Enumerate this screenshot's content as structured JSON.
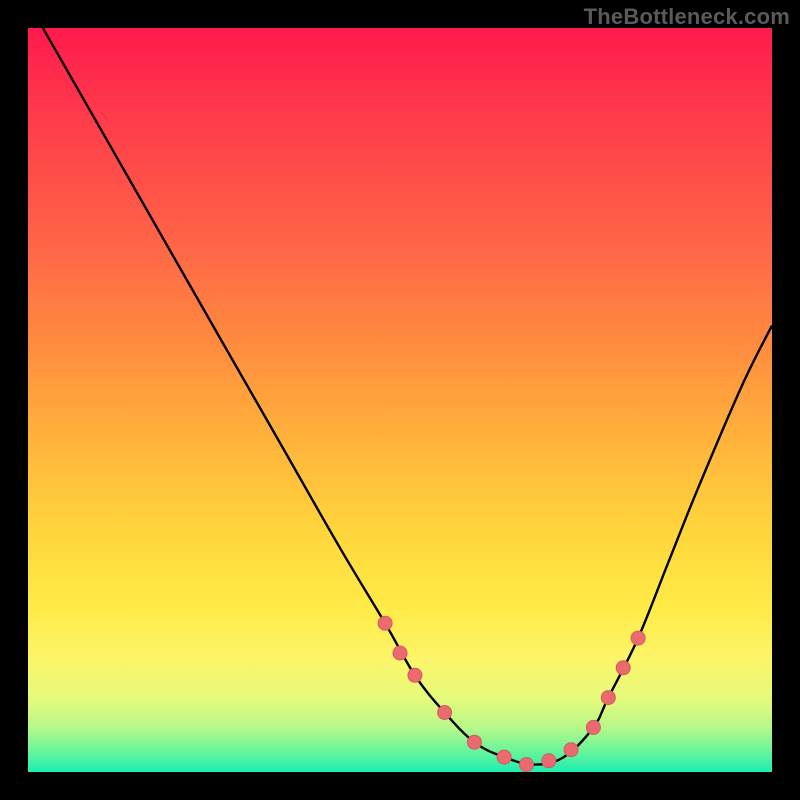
{
  "watermark": "TheBottleneck.com",
  "colors": {
    "background": "#000000",
    "curve_stroke": "#000000",
    "marker_fill": "#e96a6f",
    "marker_stroke": "#d8585e"
  },
  "chart_data": {
    "type": "line",
    "title": "",
    "xlabel": "",
    "ylabel": "",
    "xlim": [
      0,
      100
    ],
    "ylim": [
      0,
      100
    ],
    "grid": false,
    "legend": false,
    "series": [
      {
        "name": "bottleneck-curve",
        "x": [
          2,
          10,
          18,
          26,
          34,
          42,
          48,
          52,
          56,
          60,
          64,
          68,
          72,
          76,
          78,
          82,
          86,
          90,
          96,
          100
        ],
        "y": [
          100,
          86,
          72,
          58,
          44,
          30,
          20,
          13,
          8,
          4,
          2,
          1,
          2,
          6,
          10,
          18,
          28,
          38,
          52,
          60
        ]
      }
    ],
    "markers": {
      "name": "highlight-points",
      "x": [
        48,
        50,
        52,
        56,
        60,
        64,
        67,
        70,
        73,
        76,
        78,
        80,
        82
      ],
      "y": [
        20,
        16,
        13,
        8,
        4,
        2,
        1,
        1.5,
        3,
        6,
        10,
        14,
        18
      ]
    }
  }
}
